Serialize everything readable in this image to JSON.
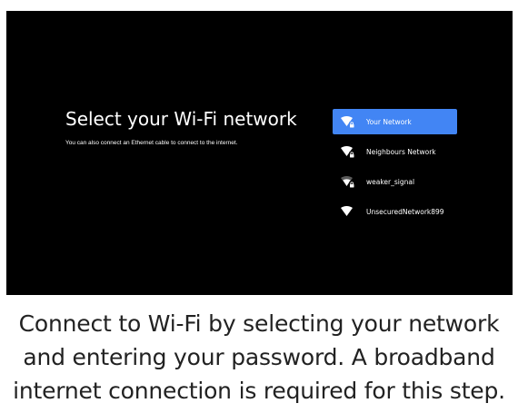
{
  "colors": {
    "accent": "#4285f4",
    "screen_bg": "#000000",
    "caption_text": "#222222"
  },
  "screen": {
    "title": "Select your Wi-Fi network",
    "subtitle": "You can also connect an Ethernet cable to connect to the internet.",
    "networks": [
      {
        "label": "Your Network",
        "icon": "wifi-locked-icon",
        "selected": true,
        "signal": 1.0
      },
      {
        "label": "Neighbours Network",
        "icon": "wifi-locked-icon",
        "selected": false,
        "signal": 1.0
      },
      {
        "label": "weaker_signal",
        "icon": "wifi-weak-locked-icon",
        "selected": false,
        "signal": 0.6
      },
      {
        "label": "UnsecuredNetwork899",
        "icon": "wifi-icon",
        "selected": false,
        "signal": 1.0
      }
    ]
  },
  "caption": {
    "line1": "Connect to Wi-Fi by selecting your network",
    "line2": "and entering your password. A broadband",
    "line3": "internet connection is required for this step."
  }
}
